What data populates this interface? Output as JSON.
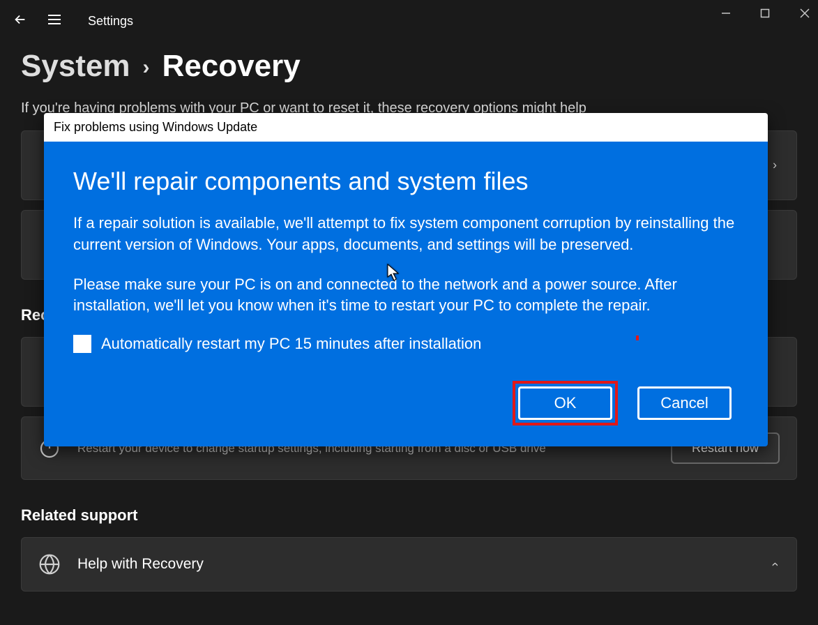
{
  "titlebar": {
    "title": "Settings"
  },
  "breadcrumb": {
    "parent": "System",
    "current": "Recovery"
  },
  "intro": "If you're having problems with your PC or want to reset it, these recovery options might help",
  "recovery_options": {
    "section_label": "Recovery options",
    "items": [
      {
        "subtitle": "Restart your device to change startup settings, including starting from a disc or USB drive",
        "button": "Restart now"
      }
    ]
  },
  "related_support": {
    "section_label": "Related support",
    "items": [
      {
        "title": "Help with Recovery"
      }
    ]
  },
  "dialog": {
    "window_title": "Fix problems using Windows Update",
    "heading": "We'll repair components and system files",
    "para1": "If a repair solution is available, we'll attempt to fix system component corruption by reinstalling the current version of Windows. Your apps, documents, and settings will be preserved.",
    "para2": "Please make sure your PC is on and connected to the network and a power source. After installation, we'll let you know when it's time to restart your PC to complete the repair.",
    "checkbox_label": "Automatically restart my PC 15 minutes after installation",
    "checkbox_checked": false,
    "ok_label": "OK",
    "cancel_label": "Cancel",
    "highlighted_button": "ok"
  }
}
